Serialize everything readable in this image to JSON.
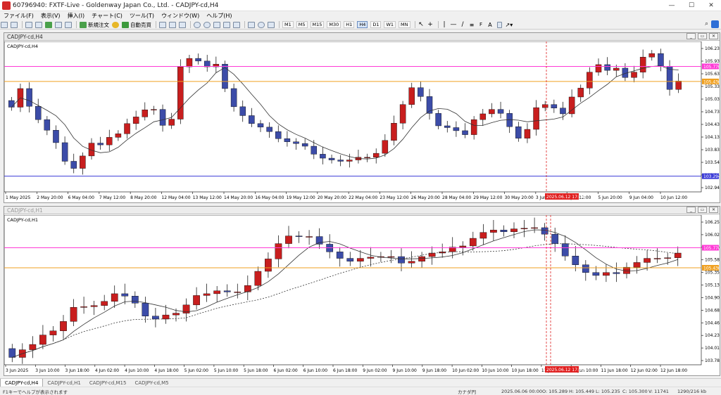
{
  "window": {
    "title": "60796940: FXTF-Live - Goldenway Japan Co., Ltd. - CADJPY-cd,H4"
  },
  "menu": [
    "ファイル(F)",
    "表示(V)",
    "挿入(I)",
    "チャート(C)",
    "ツール(T)",
    "ウィンドウ(W)",
    "ヘルプ(H)"
  ],
  "toolbar": {
    "new_order_label": "新規注文",
    "auto_trade_label": "自動売買",
    "timeframes": [
      "M1",
      "M5",
      "M15",
      "M30",
      "H1",
      "H4",
      "D1",
      "W1",
      "MN"
    ],
    "active_timeframe": "H4"
  },
  "chart_top": {
    "window_title": "CADJPY-cd,H4",
    "inner_label": "CADJPY-cd,H4",
    "chart_data": {
      "type": "candlestick",
      "symbol": "CADJPY-cd",
      "timeframe": "H4",
      "y_ticks": [
        "106.230",
        "105.930",
        "105.630",
        "105.330",
        "105.035",
        "104.735",
        "104.435",
        "104.135",
        "103.835",
        "103.540",
        "103.240",
        "102.940"
      ],
      "ylim": [
        102.94,
        106.3
      ],
      "x_ticks": [
        "1 May 2025",
        "2 May 20:00",
        "6 May 04:00",
        "7 May 12:00",
        "8 May 20:00",
        "12 May 04:00",
        "13 May 12:00",
        "14 May 20:00",
        "16 May 04:00",
        "19 May 12:00",
        "20 May 20:00",
        "22 May 04:00",
        "23 May 12:00",
        "26 May 20:00",
        "28 May 04:00",
        "29 May 12:00",
        "30 May 20:00",
        "3 Jun 04:00",
        "4 Jun 12:00",
        "5 Jun 20:00",
        "9 Jun 04:00",
        "10 Jun 12:00"
      ],
      "h_lines": [
        {
          "label": "105.770",
          "value": 105.77,
          "color": "#ff3ad6"
        },
        {
          "label": "105.430",
          "value": 105.43,
          "color": "#f0a020"
        },
        {
          "label": "103.294",
          "value": 103.294,
          "color": "#3c3cd8"
        }
      ],
      "vline_label": "2025.06.12 17:00",
      "closes": [
        104.85,
        105.27,
        104.87,
        104.57,
        104.33,
        104.05,
        103.63,
        103.47,
        103.75,
        104.04,
        104.0,
        104.17,
        104.25,
        104.48,
        104.63,
        104.79,
        104.8,
        104.44,
        104.58,
        105.76,
        105.95,
        105.89,
        105.76,
        105.82,
        105.27,
        104.86,
        104.66,
        104.48,
        104.4,
        104.3,
        104.14,
        104.07,
        104.03,
        103.97,
        103.79,
        103.7,
        103.66,
        103.63,
        103.66,
        103.72,
        103.72,
        103.81,
        104.1,
        104.49,
        104.91,
        105.29,
        105.09,
        104.71,
        104.43,
        104.39,
        104.32,
        104.23,
        104.57,
        104.7,
        104.8,
        104.71,
        104.41,
        104.15,
        104.35,
        104.84,
        104.91,
        104.83,
        104.7,
        105.08,
        105.28,
        105.64,
        105.81,
        105.68,
        105.73,
        105.52,
        105.64,
        105.98,
        106.06,
        105.77,
        105.25,
        105.44
      ],
      "ma_series": "one moving average line"
    }
  },
  "chart_bottom": {
    "window_title": "CADJPY-cd,H1",
    "inner_label": "CADJPY-cd,H1",
    "chart_data": {
      "type": "candlestick",
      "symbol": "CADJPY-cd",
      "timeframe": "H1",
      "y_ticks": [
        "106.250",
        "106.025",
        "105.805",
        "105.580",
        "105.355",
        "105.130",
        "104.905",
        "104.685",
        "104.460",
        "104.235",
        "104.010",
        "103.785"
      ],
      "ylim": [
        103.785,
        106.3
      ],
      "x_ticks": [
        "3 Jun 2025",
        "3 Jun 10:00",
        "3 Jun 18:00",
        "4 Jun 02:00",
        "4 Jun 10:00",
        "4 Jun 18:00",
        "5 Jun 02:00",
        "5 Jun 10:00",
        "5 Jun 18:00",
        "6 Jun 02:00",
        "6 Jun 10:00",
        "6 Jun 18:00",
        "9 Jun 02:00",
        "9 Jun 10:00",
        "9 Jun 18:00",
        "10 Jun 02:00",
        "10 Jun 10:00",
        "10 Jun 18:00",
        "11 Jun 02:00",
        "11 Jun 10:00",
        "11 Jun 18:00",
        "12 Jun 02:00",
        "12 Jun 18:00"
      ],
      "h_lines": [
        {
          "label": "105.770",
          "value": 105.77,
          "color": "#ff3ad6"
        },
        {
          "label": "105.430",
          "value": 105.43,
          "color": "#f0a020"
        }
      ],
      "vline_label": "2025.06.12 17:00",
      "closes": [
        103.91,
        104.04,
        104.13,
        104.29,
        104.36,
        104.52,
        104.76,
        104.77,
        104.79,
        104.86,
        104.99,
        104.95,
        104.83,
        104.61,
        104.56,
        104.63,
        104.66,
        104.8,
        104.96,
        104.99,
        105.04,
        105.02,
        105.02,
        105.13,
        105.37,
        105.58,
        105.84,
        105.97,
        105.96,
        105.96,
        105.83,
        105.7,
        105.59,
        105.54,
        105.59,
        105.61,
        105.62,
        105.62,
        105.51,
        105.54,
        105.62,
        105.68,
        105.7,
        105.78,
        105.8,
        105.93,
        106.03,
        106.07,
        106.04,
        106.09,
        106.1,
        106.11,
        106.0,
        105.84,
        105.63,
        105.48,
        105.35,
        105.3,
        105.35,
        105.33,
        105.44,
        105.52,
        105.59,
        105.59,
        105.6,
        105.68
      ],
      "ma_series": "solid moving average and dotted moving average"
    }
  },
  "bottom_tabs": [
    "CADJPY-cd,H4",
    "CADJPY-cd,H1",
    "CADJPY-cd,M15",
    "CADJPY-cd,M5"
  ],
  "status": {
    "help": "F1キーでヘルプが表示されます",
    "profile": "カナダ円",
    "datetime": "2025.06.06 00:00",
    "o": "O: 105.289",
    "h": "H: 105.449",
    "l": "L: 105.235",
    "c": "C: 105.300",
    "v": "V: 11741",
    "traffic": "1290/216 kb"
  },
  "colors": {
    "bull": "#c81e1e",
    "bear": "#3c4ca8",
    "ma": "#333333",
    "vline": "#e02020",
    "cycle_curve": "#e8963a"
  }
}
